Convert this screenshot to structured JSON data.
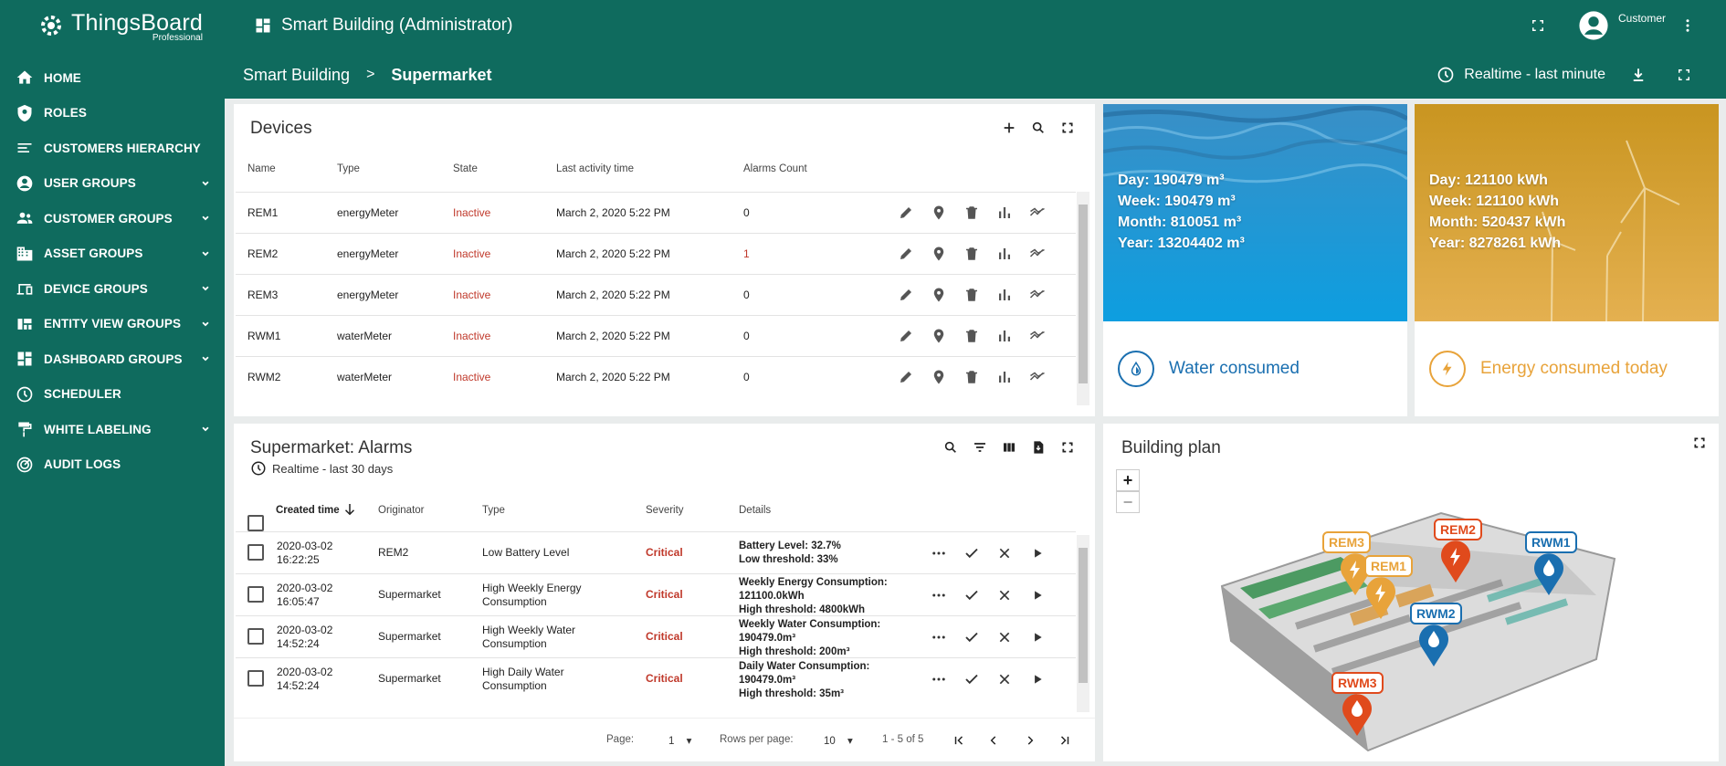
{
  "app": {
    "brand": "ThingsBoard",
    "brand_sub": "Professional",
    "dashboard_title": "Smart Building (Administrator)",
    "user_name": "Customer"
  },
  "colors": {
    "primary": "#0f6b5e",
    "inactive": "#c0392b",
    "critical": "#c0392b",
    "water": "#1a6fb0",
    "energy": "#e8a33a"
  },
  "sidebar": {
    "items": [
      {
        "label": "HOME",
        "icon": "home-icon",
        "expandable": false
      },
      {
        "label": "ROLES",
        "icon": "shield-icon",
        "expandable": false
      },
      {
        "label": "CUSTOMERS HIERARCHY",
        "icon": "hierarchy-icon",
        "expandable": false
      },
      {
        "label": "USER GROUPS",
        "icon": "account-circle-icon",
        "expandable": true
      },
      {
        "label": "CUSTOMER GROUPS",
        "icon": "people-icon",
        "expandable": true
      },
      {
        "label": "ASSET GROUPS",
        "icon": "domain-icon",
        "expandable": true
      },
      {
        "label": "DEVICE GROUPS",
        "icon": "devices-icon",
        "expandable": true
      },
      {
        "label": "ENTITY VIEW GROUPS",
        "icon": "view-quilt-icon",
        "expandable": true
      },
      {
        "label": "DASHBOARD GROUPS",
        "icon": "dashboard-icon",
        "expandable": true
      },
      {
        "label": "SCHEDULER",
        "icon": "schedule-icon",
        "expandable": false
      },
      {
        "label": "WHITE LABELING",
        "icon": "format-paint-icon",
        "expandable": true
      },
      {
        "label": "AUDIT LOGS",
        "icon": "track-changes-icon",
        "expandable": false
      }
    ]
  },
  "breadcrumb": {
    "parent": "Smart Building",
    "separator": ">",
    "current": "Supermarket"
  },
  "timewindow": {
    "label": "Realtime - last minute"
  },
  "devices": {
    "title": "Devices",
    "columns": [
      "Name",
      "Type",
      "State",
      "Last activity time",
      "Alarms Count"
    ],
    "rows": [
      {
        "name": "REM1",
        "type": "energyMeter",
        "state": "Inactive",
        "last": "March 2, 2020 5:22 PM",
        "alarms": "0"
      },
      {
        "name": "REM2",
        "type": "energyMeter",
        "state": "Inactive",
        "last": "March 2, 2020 5:22 PM",
        "alarms": "1"
      },
      {
        "name": "REM3",
        "type": "energyMeter",
        "state": "Inactive",
        "last": "March 2, 2020 5:22 PM",
        "alarms": "0"
      },
      {
        "name": "RWM1",
        "type": "waterMeter",
        "state": "Inactive",
        "last": "March 2, 2020 5:22 PM",
        "alarms": "0"
      },
      {
        "name": "RWM2",
        "type": "waterMeter",
        "state": "Inactive",
        "last": "March 2, 2020 5:22 PM",
        "alarms": "0"
      }
    ]
  },
  "alarms": {
    "title": "Supermarket: Alarms",
    "subtitle": "Realtime - last 30 days",
    "columns": [
      "Created time",
      "Originator",
      "Type",
      "Severity",
      "Details"
    ],
    "rows": [
      {
        "date": "2020-03-02",
        "time": "16:22:25",
        "originator": "REM2",
        "type1": "Low Battery Level",
        "type2": "",
        "severity": "Critical",
        "d1": "Battery Level: 32.7%",
        "d2": "Low threshold: 33%",
        "d3": ""
      },
      {
        "date": "2020-03-02",
        "time": "16:05:47",
        "originator": "Supermarket",
        "type1": "High Weekly Energy",
        "type2": "Consumption",
        "severity": "Critical",
        "d1": "Weekly Energy Consumption:",
        "d2": "121100.0kWh",
        "d3": "High threshold: 4800kWh"
      },
      {
        "date": "2020-03-02",
        "time": "14:52:24",
        "originator": "Supermarket",
        "type1": "High Weekly Water",
        "type2": "Consumption",
        "severity": "Critical",
        "d1": "Weekly Water Consumption:",
        "d2": "190479.0m³",
        "d3": "High threshold: 200m³"
      },
      {
        "date": "2020-03-02",
        "time": "14:52:24",
        "originator": "Supermarket",
        "type1": "High Daily Water",
        "type2": "Consumption",
        "severity": "Critical",
        "d1": "Daily Water Consumption:",
        "d2": "190479.0m³",
        "d3": "High threshold: 35m³"
      }
    ],
    "pager": {
      "page_label": "Page:",
      "page": "1",
      "rows_label": "Rows per page:",
      "rows": "10",
      "range": "1 - 5 of 5"
    }
  },
  "water": {
    "lines": [
      "Day: 190479 m³",
      "Week: 190479 m³",
      "Month: 810051 m³",
      "Year: 13204402 m³"
    ],
    "label": "Water consumed"
  },
  "energy": {
    "lines": [
      "Day: 121100 kWh",
      "Week: 121100 kWh",
      "Month: 520437 kWh",
      "Year: 8278261 kWh"
    ],
    "label": "Energy consumed today"
  },
  "plan": {
    "title": "Building plan",
    "zoom_in": "+",
    "zoom_out": "−",
    "markers": [
      {
        "label": "REM3",
        "kind": "energy"
      },
      {
        "label": "REM2",
        "kind": "energy-alarm"
      },
      {
        "label": "RWM1",
        "kind": "water"
      },
      {
        "label": "REM1",
        "kind": "energy"
      },
      {
        "label": "RWM2",
        "kind": "water"
      },
      {
        "label": "RWM3",
        "kind": "water-alarm"
      }
    ]
  }
}
